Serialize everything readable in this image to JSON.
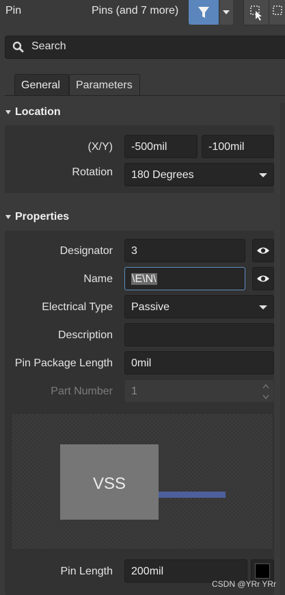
{
  "header": {
    "title": "Pin",
    "filter_summary": "Pins (and 7 more)"
  },
  "search": {
    "placeholder": "Search"
  },
  "tabs": [
    {
      "label": "General",
      "active": true
    },
    {
      "label": "Parameters",
      "active": false
    }
  ],
  "location": {
    "title": "Location",
    "xy_label": "(X/Y)",
    "x_value": "-500mil",
    "y_value": "-100mil",
    "rotation_label": "Rotation",
    "rotation_value": "180 Degrees"
  },
  "properties": {
    "title": "Properties",
    "designator_label": "Designator",
    "designator_value": "3",
    "name_label": "Name",
    "name_value": "\\E\\N\\",
    "electrical_type_label": "Electrical Type",
    "electrical_type_value": "Passive",
    "description_label": "Description",
    "description_value": "",
    "pin_package_length_label": "Pin Package Length",
    "pin_package_length_value": "0mil",
    "part_number_label": "Part Number",
    "part_number_value": "1",
    "preview_pin_name": "VSS",
    "pin_length_label": "Pin Length",
    "pin_length_value": "200mil",
    "pin_color": "#000000"
  },
  "watermark": "CSDN @YRr YRr",
  "colors": {
    "accent": "#5b86bd",
    "panel_bg": "#3a3a3a",
    "field_bg": "#262626",
    "pin_line": "#4d5f9d"
  }
}
